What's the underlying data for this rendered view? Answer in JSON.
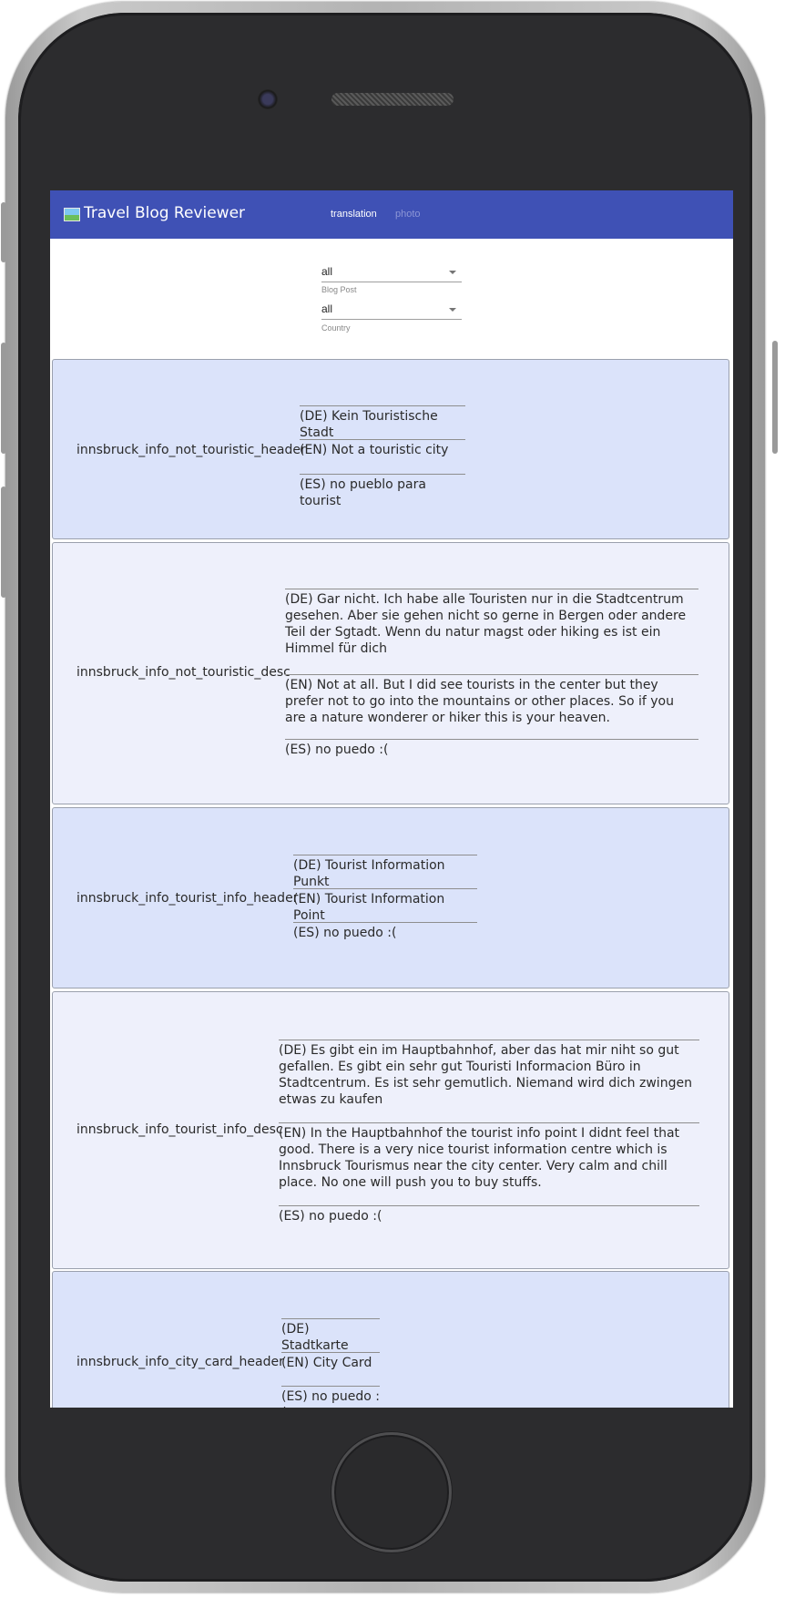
{
  "app": {
    "title": "Travel Blog Reviewer",
    "tabs": [
      {
        "label": "translation",
        "active": true
      },
      {
        "label": "photo",
        "active": false
      }
    ]
  },
  "filters": {
    "blog_post": {
      "value": "all",
      "label": "Blog Post"
    },
    "country": {
      "value": "all",
      "label": "Country"
    }
  },
  "entries": [
    {
      "key": "innsbruck_info_not_touristic_header",
      "de": "(DE) Kein Touristische Stadt",
      "en": "(EN) Not a touristic city",
      "es": "(ES) no pueblo para tourist"
    },
    {
      "key": "innsbruck_info_not_touristic_desc",
      "de": "(DE) Gar nicht. Ich habe alle Touristen nur in die Stadtcentrum gesehen. Aber sie gehen nicht so gerne in Bergen oder andere Teil der Sgtadt. Wenn du natur magst oder hiking es ist ein Himmel für dich",
      "en": "(EN) Not at all. But I did see tourists in the center but they prefer not to go into the mountains or other places. So if you are a nature wonderer or hiker this is your heaven.",
      "es": "(ES) no puedo :("
    },
    {
      "key": "innsbruck_info_tourist_info_header",
      "de": "(DE) Tourist Information Punkt",
      "en": "(EN) Tourist Information Point",
      "es": "(ES) no puedo :("
    },
    {
      "key": "innsbruck_info_tourist_info_desc",
      "de": "(DE) Es gibt ein im Hauptbahnhof, aber das hat mir niht so gut gefallen. Es gibt ein sehr gut Touristi Informacion Büro in Stadtcentrum. Es ist sehr gemutlich. Niemand wird dich zwingen etwas zu kaufen",
      "en": "(EN) In the Hauptbahnhof the tourist info point I didnt feel that good. There is a very nice tourist information centre which is Innsbruck Tourismus near the city center. Very calm and chill place. No one will push you to buy stuffs.",
      "es": "(ES) no puedo :("
    },
    {
      "key": "innsbruck_info_city_card_header",
      "de": "(DE) Stadtkarte",
      "en": "(EN) City Card",
      "es": "(ES) no puedo :("
    }
  ]
}
